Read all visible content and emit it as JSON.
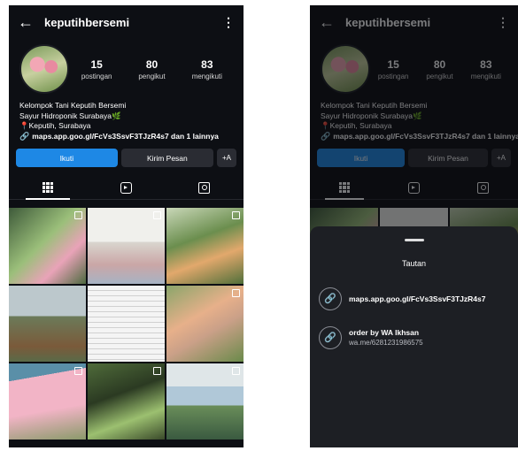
{
  "profile": {
    "username": "keputihbersemi",
    "back_glyph": "←",
    "menu_glyph": "⋮",
    "stats": [
      {
        "num": "15",
        "label": "postingan"
      },
      {
        "num": "80",
        "label": "pengikut"
      },
      {
        "num": "83",
        "label": "mengikuti"
      }
    ],
    "bio": {
      "line1": "Kelompok Tani Keputih Bersemi",
      "line2": "Sayur Hidroponik Surabaya",
      "line3": "Keputih, Surabaya",
      "link": "maps.app.goo.gl/FcVs3SsvF3TJzR4s7 dan 1 lainnya"
    },
    "buttons": {
      "follow": "Ikuti",
      "message": "Kirim Pesan",
      "add_person": "+A"
    }
  },
  "sheet": {
    "title": "Tautan",
    "links": [
      {
        "title": "maps.app.goo.gl/FcVs3SsvF3TJzR4s7",
        "subtitle": ""
      },
      {
        "title": "order by WA Ikhsan",
        "subtitle": "wa.me/6281231986575"
      }
    ]
  },
  "icons": {
    "back": "arrow-left-icon",
    "menu": "more-vert-icon",
    "link": "link-icon",
    "grid_tab": "grid-icon",
    "reels_tab": "reels-icon",
    "tagged_tab": "tagged-icon"
  },
  "colors": {
    "background": "#0d0f14",
    "follow_button": "#1e88e5",
    "secondary_button": "#2a2c33",
    "sheet": "#1d1f24"
  }
}
